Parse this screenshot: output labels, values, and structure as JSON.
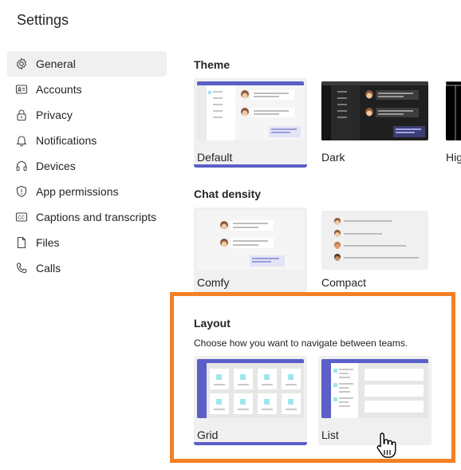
{
  "title": "Settings",
  "nav": {
    "items": [
      {
        "label": "General",
        "icon": "gear-icon"
      },
      {
        "label": "Accounts",
        "icon": "id-card-icon"
      },
      {
        "label": "Privacy",
        "icon": "lock-icon"
      },
      {
        "label": "Notifications",
        "icon": "bell-icon"
      },
      {
        "label": "Devices",
        "icon": "headset-icon"
      },
      {
        "label": "App permissions",
        "icon": "shield-icon"
      },
      {
        "label": "Captions and transcripts",
        "icon": "cc-icon"
      },
      {
        "label": "Files",
        "icon": "file-icon"
      },
      {
        "label": "Calls",
        "icon": "phone-icon"
      }
    ]
  },
  "theme": {
    "title": "Theme",
    "options": [
      "Default",
      "Dark",
      "Hig"
    ]
  },
  "density": {
    "title": "Chat density",
    "options": [
      "Comfy",
      "Compact"
    ]
  },
  "layout": {
    "title": "Layout",
    "description": "Choose how you want to navigate between teams.",
    "options": [
      "Grid",
      "List"
    ]
  },
  "colors": {
    "accent": "#5b5fc7",
    "highlight": "#f48024"
  }
}
